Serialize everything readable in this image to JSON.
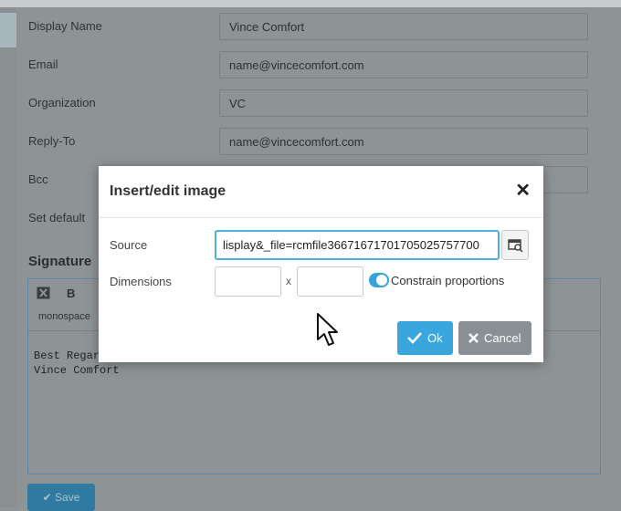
{
  "settings": {
    "rows": [
      {
        "label": "Display Name",
        "value": "Vince Comfort"
      },
      {
        "label": "Email",
        "value": "name@vincecomfort.com"
      },
      {
        "label": "Organization",
        "value": "VC"
      },
      {
        "label": "Reply-To",
        "value": "name@vincecomfort.com"
      },
      {
        "label": "Bcc",
        "value": ""
      },
      {
        "label": "Set default",
        "value": ""
      }
    ],
    "signature_title": "Signature",
    "toolbar": {
      "bold": "B",
      "font": "monospace"
    },
    "signature_text": "Best Regar\nVince Comfort",
    "save_label": "Save"
  },
  "dialog": {
    "title": "Insert/edit image",
    "close": "✕",
    "source_label": "Source",
    "source_value": "lisplay&_file=rcmfile36671671701705025757700",
    "dimensions_label": "Dimensions",
    "width_value": "",
    "height_value": "",
    "x_sep": "x",
    "constrain_label": "Constrain proportions",
    "constrain_on": true,
    "ok_label": "Ok",
    "cancel_label": "Cancel"
  }
}
